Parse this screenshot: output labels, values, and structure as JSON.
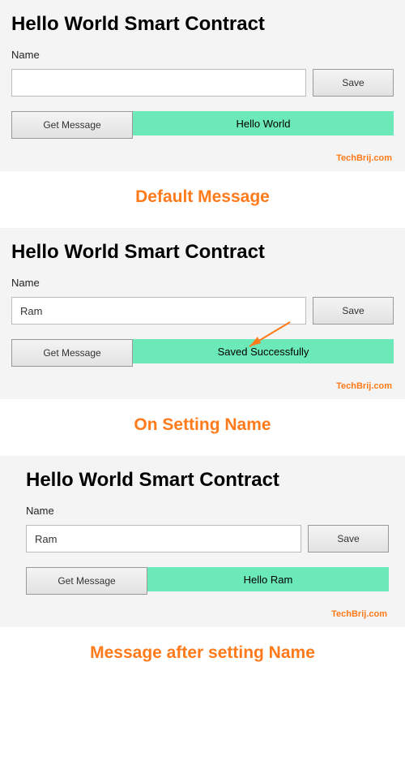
{
  "panels": [
    {
      "title": "Hello World Smart Contract",
      "label": "Name",
      "inputValue": "",
      "saveLabel": "Save",
      "getLabel": "Get Message",
      "result": "Hello World",
      "watermark": "TechBrij.com",
      "caption": "Default Message"
    },
    {
      "title": "Hello World Smart Contract",
      "label": "Name",
      "inputValue": "Ram",
      "saveLabel": "Save",
      "getLabel": "Get Message",
      "result": "Saved Successfully",
      "watermark": "TechBrij.com",
      "caption": "On Setting Name"
    },
    {
      "title": "Hello World Smart Contract",
      "label": "Name",
      "inputValue": "Ram",
      "saveLabel": "Save",
      "getLabel": "Get Message",
      "result": "Hello Ram",
      "watermark": "TechBrij.com",
      "caption": "Message after setting Name"
    }
  ]
}
